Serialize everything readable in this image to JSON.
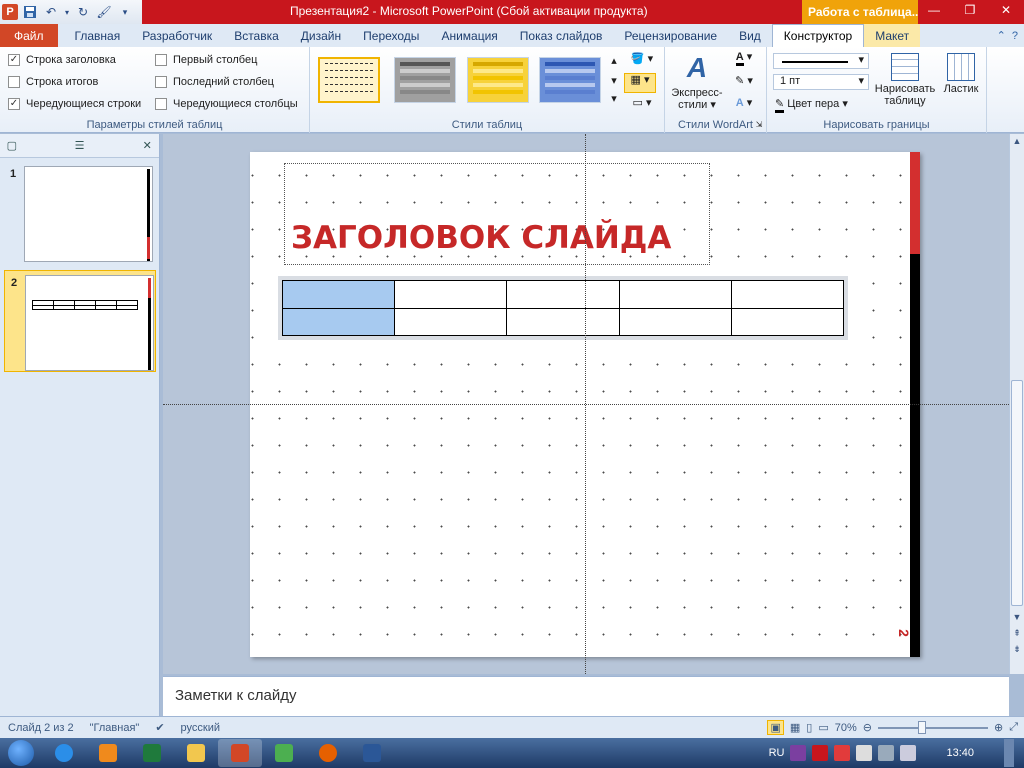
{
  "titlebar": {
    "title": "Презентация2  -  Microsoft PowerPoint (Сбой активации продукта)",
    "contextual_header": "Работа с таблица..."
  },
  "tabs": [
    "Файл",
    "Главная",
    "Разработчик",
    "Вставка",
    "Дизайн",
    "Переходы",
    "Анимация",
    "Показ слайдов",
    "Рецензирование",
    "Вид",
    "Конструктор",
    "Макет"
  ],
  "ribbon": {
    "table_style_options": {
      "header_row": "Строка заголовка",
      "total_row": "Строка итогов",
      "banded_rows": "Чередующиеся строки",
      "first_column": "Первый столбец",
      "last_column": "Последний столбец",
      "banded_columns": "Чередующиеся столбцы",
      "label": "Параметры стилей таблиц"
    },
    "table_styles": {
      "label": "Стили таблиц"
    },
    "wordart": {
      "express_line1": "Экспресс-",
      "express_line2": "стили ▾",
      "label": "Стили WordArt"
    },
    "borders": {
      "pen_weight": "1 пт",
      "pen_color": "Цвет пера ▾",
      "draw_line1": "Нарисовать",
      "draw_line2": "таблицу",
      "eraser": "Ластик",
      "label": "Нарисовать границы"
    }
  },
  "slides_panel": {
    "slide1_num": "1",
    "slide2_num": "2"
  },
  "slide": {
    "title": "ЗАГОЛОВОК СЛАЙДА",
    "number": "2"
  },
  "notes": {
    "placeholder": "Заметки к слайду"
  },
  "status": {
    "slide_info": "Слайд 2 из 2",
    "theme": "\"Главная\"",
    "language": "русский",
    "zoom": "70%"
  },
  "taskbar": {
    "lang": "RU",
    "time": "13:40"
  },
  "colors": {
    "accent_red": "#c62828",
    "file_tab": "#d24726",
    "contextual": "#f0a30a"
  }
}
